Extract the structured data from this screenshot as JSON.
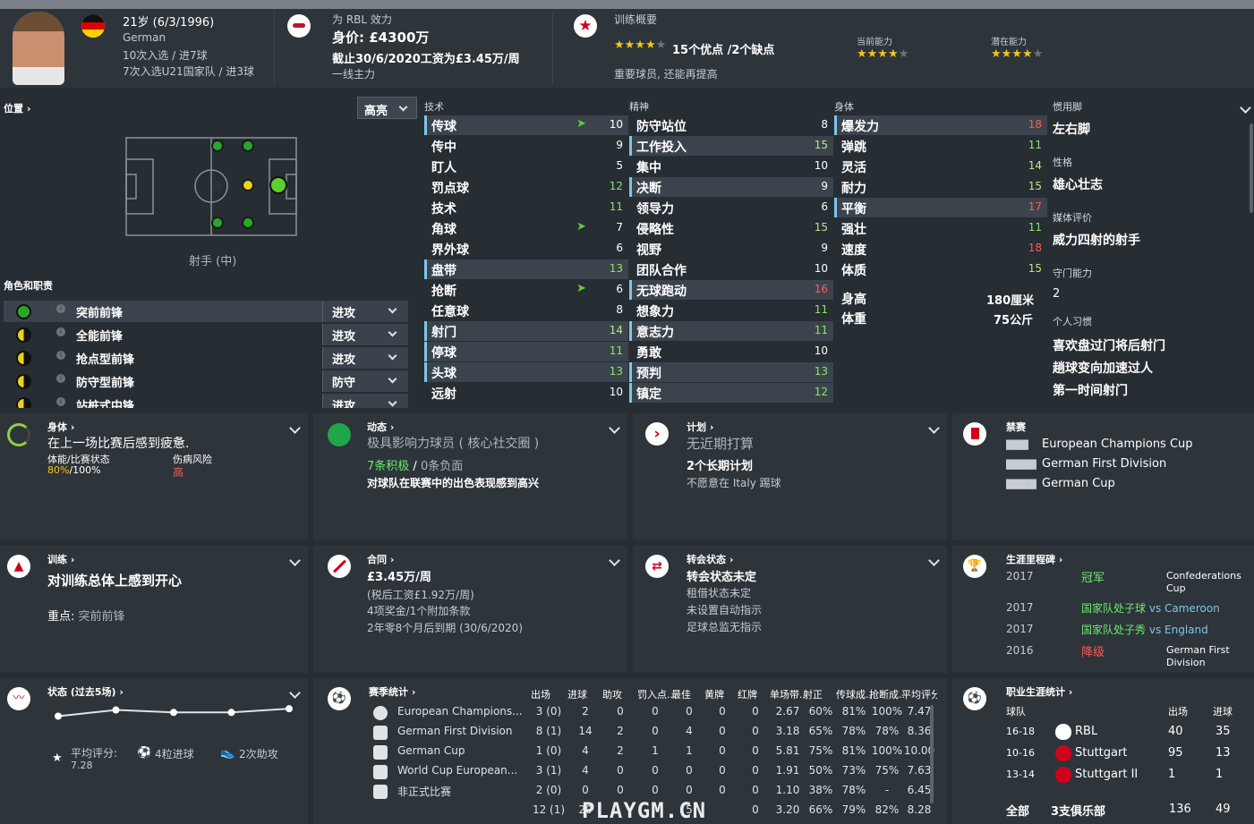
{
  "header": {
    "age": "21岁 (6/3/1996)",
    "nation": "German",
    "caps": "10次入选 / 进7球",
    "u21": "7次入选U21国家队 / 进3球",
    "club_label": "为 RBL 效力",
    "value": "身价: £4300万",
    "contract": "截止30/6/2020工资为£3.45万/周",
    "squad": "一线主力",
    "training_title": "训练概要",
    "training_summary": "15个优点 /2个缺点",
    "training_note": "重要球员, 还能再提高",
    "current_ability": "当前能力",
    "potential_ability": "潜在能力",
    "stars_summary": 4,
    "ca_stars": 4,
    "pa_stars": 4
  },
  "position": {
    "title": "位置 ›",
    "dropdown": "高亮",
    "role_label": "射手 (中)",
    "roles_title": "角色和职责"
  },
  "roles": [
    {
      "name": "突前前锋",
      "duty": "进攻"
    },
    {
      "name": "全能前锋",
      "duty": "进攻"
    },
    {
      "name": "抢点型前锋",
      "duty": "进攻"
    },
    {
      "name": "防守型前锋",
      "duty": "防守"
    },
    {
      "name": "站桩式中锋",
      "duty": "进攻"
    }
  ],
  "attributes": {
    "technical_title": "技术",
    "mental_title": "精神",
    "physical_title": "身体",
    "technical": [
      [
        "传球",
        "10"
      ],
      [
        "传中",
        "9"
      ],
      [
        "盯人",
        "5"
      ],
      [
        "罚点球",
        "12"
      ],
      [
        "技术",
        "11"
      ],
      [
        "角球",
        "7"
      ],
      [
        "界外球",
        "6"
      ],
      [
        "盘带",
        "13"
      ],
      [
        "抢断",
        "6"
      ],
      [
        "任意球",
        "8"
      ],
      [
        "射门",
        "14"
      ],
      [
        "停球",
        "11"
      ],
      [
        "头球",
        "13"
      ],
      [
        "远射",
        "10"
      ]
    ],
    "mental": [
      [
        "防守站位",
        "8"
      ],
      [
        "工作投入",
        "15"
      ],
      [
        "集中",
        "10"
      ],
      [
        "决断",
        "9"
      ],
      [
        "领导力",
        "6"
      ],
      [
        "侵略性",
        "15"
      ],
      [
        "视野",
        "9"
      ],
      [
        "团队合作",
        "10"
      ],
      [
        "无球跑动",
        "16"
      ],
      [
        "想象力",
        "11"
      ],
      [
        "意志力",
        "11"
      ],
      [
        "勇敢",
        "10"
      ],
      [
        "预判",
        "13"
      ],
      [
        "镇定",
        "12"
      ]
    ],
    "physical": [
      [
        "爆发力",
        "18"
      ],
      [
        "弹跳",
        "11"
      ],
      [
        "灵活",
        "14"
      ],
      [
        "耐力",
        "15"
      ],
      [
        "平衡",
        "17"
      ],
      [
        "强壮",
        "11"
      ],
      [
        "速度",
        "18"
      ],
      [
        "体质",
        "15"
      ]
    ],
    "height_label": "身高",
    "height": "180厘米",
    "weight_label": "体重",
    "weight": "75公斤"
  },
  "side": {
    "foot_label": "惯用脚",
    "foot": "左右脚",
    "personality_label": "性格",
    "personality": "雄心壮志",
    "media_label": "媒体评价",
    "media": "威力四射的射手",
    "gk_label": "守门能力",
    "gk": "2",
    "habits_label": "个人习惯",
    "habits": [
      "喜欢盘过门将后射门",
      "趟球变向加速过人",
      "第一时间射门"
    ]
  },
  "cards": {
    "body_title": "身体 ›",
    "body_text": "在上一场比赛后感到疲惫.",
    "fitness_label": "体能/比赛状态",
    "fitness_val": "80%",
    "fitness_val2": "/100%",
    "injury_label": "伤病风险",
    "injury_val": "高",
    "dyn_title": "动态 ›",
    "dyn_text": "极具影响力球员 ( 核心社交圈 )",
    "dyn_pos": "7条积极",
    "dyn_sep": " / ",
    "dyn_neg": "0条负面",
    "dyn_note": "对球队在联赛中的出色表现感到高兴",
    "plan_title": "计划 ›",
    "plan_text": "无近期打算",
    "plan_long": "2个长期计划",
    "plan_note": "不愿意在 Italy 踢球",
    "ban_title": "禁赛",
    "bans": [
      "European Champions Cup",
      "German First Division",
      "German Cup"
    ],
    "train_title": "训练 ›",
    "train_text": "对训练总体上感到开心",
    "train_focus_label": "重点:",
    "train_focus": "突前前锋",
    "contract_title": "合同 ›",
    "contract_wage": "£3.45万/周",
    "contract_after": "(税后工资£1.92万/周)",
    "contract_bonus": "4项奖金/1个附加条款",
    "contract_expire": "2年零8个月后到期",
    "contract_date": "(30/6/2020)",
    "transfer_title": "转会状态 ›",
    "transfer_text": "转会状态未定",
    "transfer_l1": "租借状态未定",
    "transfer_l2": "未设置自动指示",
    "transfer_l3": "足球总监无指示",
    "career_title": "生涯里程碑 ›",
    "milestones": [
      {
        "year": "2017",
        "text": "冠军",
        "extra": "Confederations Cup"
      },
      {
        "year": "2017",
        "text": "国家队处子球",
        "vs": "vs Cameroon"
      },
      {
        "year": "2017",
        "text": "国家队处子秀",
        "vs": "vs England"
      },
      {
        "year": "2016",
        "text": "降级",
        "extra": "German First Division"
      }
    ],
    "form_title": "状态 (过去5场) ›",
    "form_points": [
      6.9,
      7.4,
      7.2,
      7.2,
      7.5
    ],
    "avg_label": "平均评分:",
    "avg": "7.28",
    "goals": "4粒进球",
    "assists": "2次助攻",
    "season_title": "赛季统计 ›",
    "season_headers": [
      "出场",
      "进球",
      "助攻",
      "罚入点...",
      "最佳",
      "黄牌",
      "红牌",
      "单场带...",
      "射正",
      "传球成...",
      "抢断成...",
      "平均评分"
    ],
    "season_rows": [
      {
        "comp": "European Champions...",
        "vals": [
          "3 (0)",
          "2",
          "0",
          "0",
          "0",
          "0",
          "0",
          "2.67",
          "60%",
          "81%",
          "100%",
          "7.47"
        ]
      },
      {
        "comp": "German First Division",
        "vals": [
          "8 (1)",
          "14",
          "2",
          "0",
          "4",
          "0",
          "0",
          "3.18",
          "65%",
          "78%",
          "78%",
          "8.36"
        ]
      },
      {
        "comp": "German Cup",
        "vals": [
          "1 (0)",
          "4",
          "2",
          "1",
          "1",
          "0",
          "0",
          "5.81",
          "75%",
          "81%",
          "100%",
          "10.00"
        ]
      },
      {
        "comp": "World Cup European...",
        "vals": [
          "3 (1)",
          "4",
          "0",
          "0",
          "0",
          "0",
          "0",
          "1.91",
          "50%",
          "73%",
          "75%",
          "7.63"
        ]
      },
      {
        "comp": "非正式比赛",
        "vals": [
          "2 (0)",
          "0",
          "0",
          "0",
          "0",
          "0",
          "0",
          "1.10",
          "38%",
          "78%",
          "-",
          "6.45"
        ]
      }
    ],
    "season_total": [
      "12 (1)",
      "20",
      "",
      "",
      "5",
      "",
      "0",
      "3.20",
      "66%",
      "79%",
      "82%",
      "8.28"
    ],
    "career_stats_title": "职业生涯统计 ›",
    "cs_club_label": "球队",
    "cs_apps": "出场",
    "cs_goals": "进球",
    "career_rows": [
      {
        "season": "16-18",
        "club": "RBL",
        "apps": "40",
        "goals": "35"
      },
      {
        "season": "10-16",
        "club": "Stuttgart",
        "apps": "95",
        "goals": "13"
      },
      {
        "season": "13-14",
        "club": "Stuttgart II",
        "apps": "1",
        "goals": "1"
      }
    ],
    "career_total_label": "全部",
    "career_total_clubs": "3支俱乐部",
    "career_total_apps": "136",
    "career_total_goals": "49",
    "watermark": "PLAYGM.CN"
  },
  "colors": {
    "bg": "#262d33",
    "panel": "#2d343a",
    "highlight": "#3b444c",
    "green": "#6fe96f",
    "red": "#ff5a5a",
    "star": "#f5c518"
  }
}
